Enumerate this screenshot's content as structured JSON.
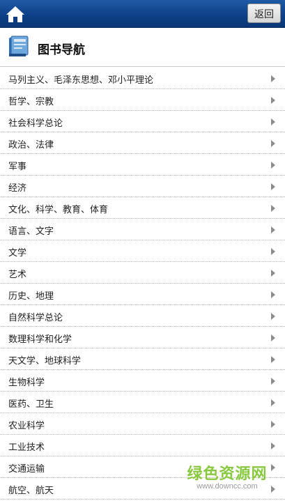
{
  "topbar": {
    "home_icon": "home-icon",
    "back_label": "返回",
    "bar_color": "#0d3f86"
  },
  "header": {
    "icon": "book-icon",
    "title": "图书导航"
  },
  "categories": [
    {
      "label": "马列主义、毛泽东思想、邓小平理论"
    },
    {
      "label": "哲学、宗教"
    },
    {
      "label": "社会科学总论"
    },
    {
      "label": "政治、法律"
    },
    {
      "label": "军事"
    },
    {
      "label": "经济"
    },
    {
      "label": "文化、科学、教育、体育"
    },
    {
      "label": "语言、文字"
    },
    {
      "label": "文学"
    },
    {
      "label": "艺术"
    },
    {
      "label": "历史、地理"
    },
    {
      "label": "自然科学总论"
    },
    {
      "label": "数理科学和化学"
    },
    {
      "label": "天文学、地球科学"
    },
    {
      "label": "生物科学"
    },
    {
      "label": "医药、卫生"
    },
    {
      "label": "农业科学"
    },
    {
      "label": "工业技术"
    },
    {
      "label": "交通运输"
    },
    {
      "label": "航空、航天"
    }
  ],
  "watermark": {
    "brand": "绿色资源网",
    "url": "www.downcc.com"
  }
}
